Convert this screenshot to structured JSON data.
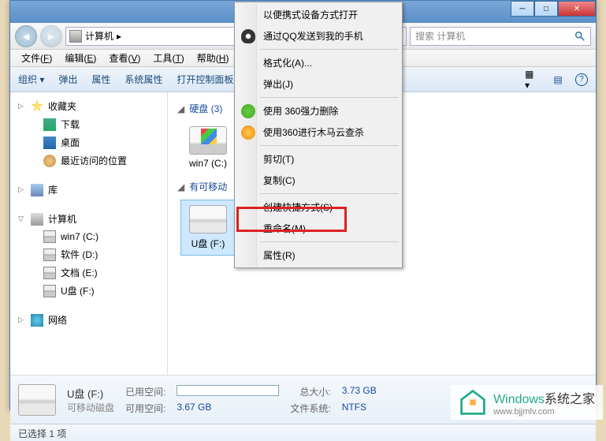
{
  "window": {
    "address": "计算机",
    "search_placeholder": "搜索 计算机"
  },
  "menubar": [
    {
      "label": "文件",
      "key": "F"
    },
    {
      "label": "编辑",
      "key": "E"
    },
    {
      "label": "查看",
      "key": "V"
    },
    {
      "label": "工具",
      "key": "T"
    },
    {
      "label": "帮助",
      "key": "H"
    }
  ],
  "toolbar": {
    "organize": "组织",
    "eject": "弹出",
    "properties": "属性",
    "sysprops": "系统属性",
    "ctrlpanel": "打开控制面板"
  },
  "sidebar": {
    "favorites": "收藏夹",
    "downloads": "下载",
    "desktop": "桌面",
    "recent": "最近访问的位置",
    "libraries": "库",
    "computer": "计算机",
    "drives": [
      "win7 (C:)",
      "软件 (D:)",
      "文档 (E:)",
      "U盘 (F:)"
    ],
    "network": "网络"
  },
  "main": {
    "group_hdd": "硬盘 (3)",
    "group_removable": "有可移动",
    "drive_win7": "win7 (C:)",
    "drive_usb": "U盘 (F:)"
  },
  "details": {
    "title": "U盘 (F:)",
    "subtitle": "可移动磁盘",
    "used_label": "已用空间:",
    "free_label": "可用空间:",
    "free_value": "3.67 GB",
    "total_label": "总大小:",
    "total_value": "3.73 GB",
    "fs_label": "文件系统:",
    "fs_value": "NTFS"
  },
  "status": "已选择 1 项",
  "contextmenu": [
    {
      "type": "item",
      "label": "以便携式设备方式打开",
      "icon": null
    },
    {
      "type": "item",
      "label": "通过QQ发送到我的手机",
      "icon": "qq"
    },
    {
      "type": "sep"
    },
    {
      "type": "item",
      "label": "格式化(A)...",
      "icon": null
    },
    {
      "type": "item",
      "label": "弹出(J)",
      "icon": null
    },
    {
      "type": "sep"
    },
    {
      "type": "item",
      "label": "使用 360强力删除",
      "icon": "360del"
    },
    {
      "type": "item",
      "label": "使用360进行木马云查杀",
      "icon": "360cloud"
    },
    {
      "type": "sep"
    },
    {
      "type": "item",
      "label": "剪切(T)",
      "icon": null
    },
    {
      "type": "item",
      "label": "复制(C)",
      "icon": null
    },
    {
      "type": "sep"
    },
    {
      "type": "item",
      "label": "创建快捷方式(S)",
      "icon": null
    },
    {
      "type": "item",
      "label": "重命名(M)",
      "icon": null
    },
    {
      "type": "sep"
    },
    {
      "type": "item",
      "label": "属性(R)",
      "icon": null
    }
  ],
  "watermark": {
    "brand": "Windows",
    "text": "系统之家",
    "url": "www.bjjmlv.com"
  }
}
